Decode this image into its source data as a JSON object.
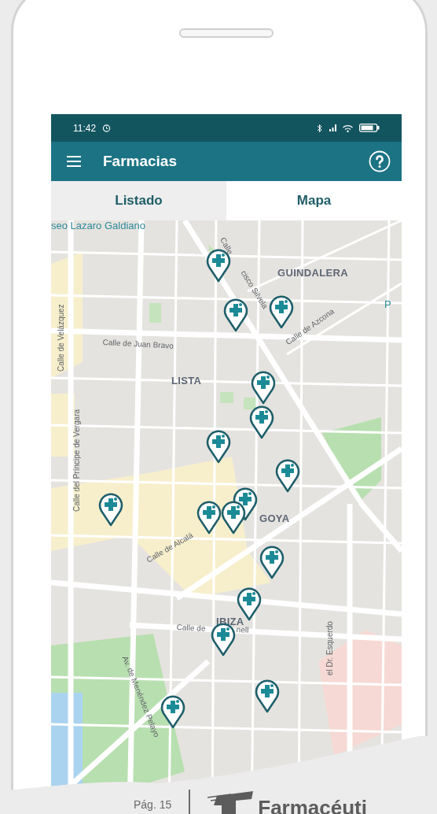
{
  "status_bar": {
    "time": "11:42"
  },
  "app_bar": {
    "title": "Farmacias"
  },
  "tabs": [
    {
      "label": "Listado",
      "selected": false
    },
    {
      "label": "Mapa",
      "selected": true
    }
  ],
  "map": {
    "labels": [
      {
        "text": "seo Lazaro Galdiano",
        "kind": "place"
      },
      {
        "text": "GUINDALERA",
        "kind": "district"
      },
      {
        "text": "LISTA",
        "kind": "district"
      },
      {
        "text": "GOYA",
        "kind": "district"
      },
      {
        "text": "IBIZA",
        "kind": "district"
      },
      {
        "text": "Calle",
        "kind": "street"
      },
      {
        "text": "cisco Silvela",
        "kind": "street"
      },
      {
        "text": "Calle de Juan Bravo",
        "kind": "street"
      },
      {
        "text": "Calle de Velázquez",
        "kind": "street"
      },
      {
        "text": "Calle de Azcona",
        "kind": "street"
      },
      {
        "text": "P",
        "kind": "place"
      },
      {
        "text": "Calle del Príncipe de Vergara",
        "kind": "street"
      },
      {
        "text": "Calle de Alcalá",
        "kind": "street"
      },
      {
        "text": "Calle de",
        "kind": "street"
      },
      {
        "text": "nell",
        "kind": "street"
      },
      {
        "text": "Av. de Menéndez Pelayo",
        "kind": "street"
      },
      {
        "text": "el Dr. Esquerdo",
        "kind": "street"
      }
    ]
  },
  "footer": {
    "page": "Pág. 15",
    "brand": "Farmacéuti"
  }
}
